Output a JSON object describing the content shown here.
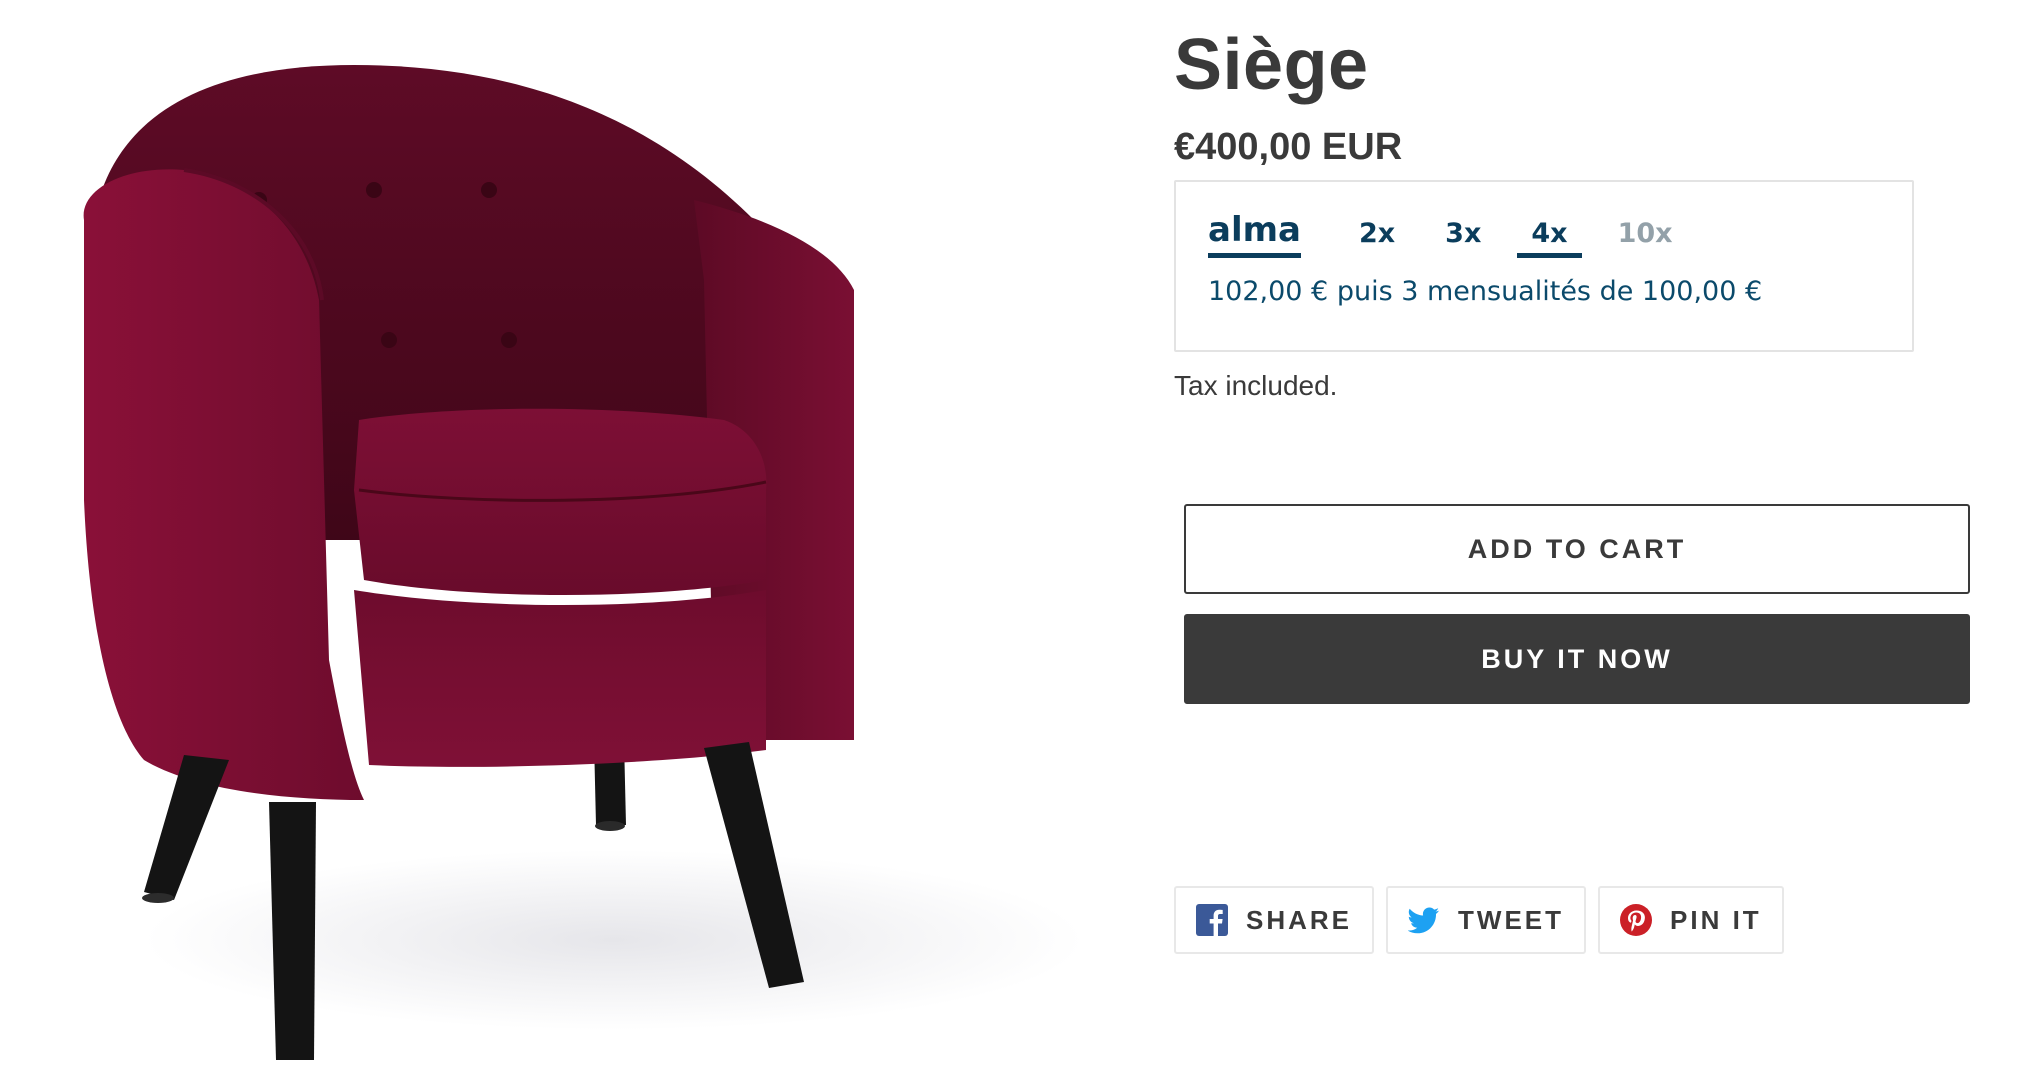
{
  "product": {
    "title": "Siège",
    "price": "€400,00 EUR",
    "tax_note": "Tax included."
  },
  "alma": {
    "logo": "alma",
    "plans": [
      {
        "label": "2x",
        "state": "normal"
      },
      {
        "label": "3x",
        "state": "normal"
      },
      {
        "label": "4x",
        "state": "active"
      },
      {
        "label": "10x",
        "state": "disabled"
      }
    ],
    "description": "102,00 € puis 3 mensualités de 100,00 €",
    "color": "#0b3d5c"
  },
  "actions": {
    "add_to_cart": "ADD TO CART",
    "buy_now": "BUY IT NOW"
  },
  "share": {
    "facebook": {
      "label": "SHARE",
      "icon": "facebook-icon",
      "color": "#3b5998"
    },
    "twitter": {
      "label": "TWEET",
      "icon": "twitter-icon",
      "color": "#1da1f2"
    },
    "pinterest": {
      "label": "PIN IT",
      "icon": "pinterest-icon",
      "color": "#cb2027"
    }
  },
  "image": {
    "subject": "armchair",
    "fabric_color": "#7a0f33",
    "leg_color": "#141414"
  }
}
